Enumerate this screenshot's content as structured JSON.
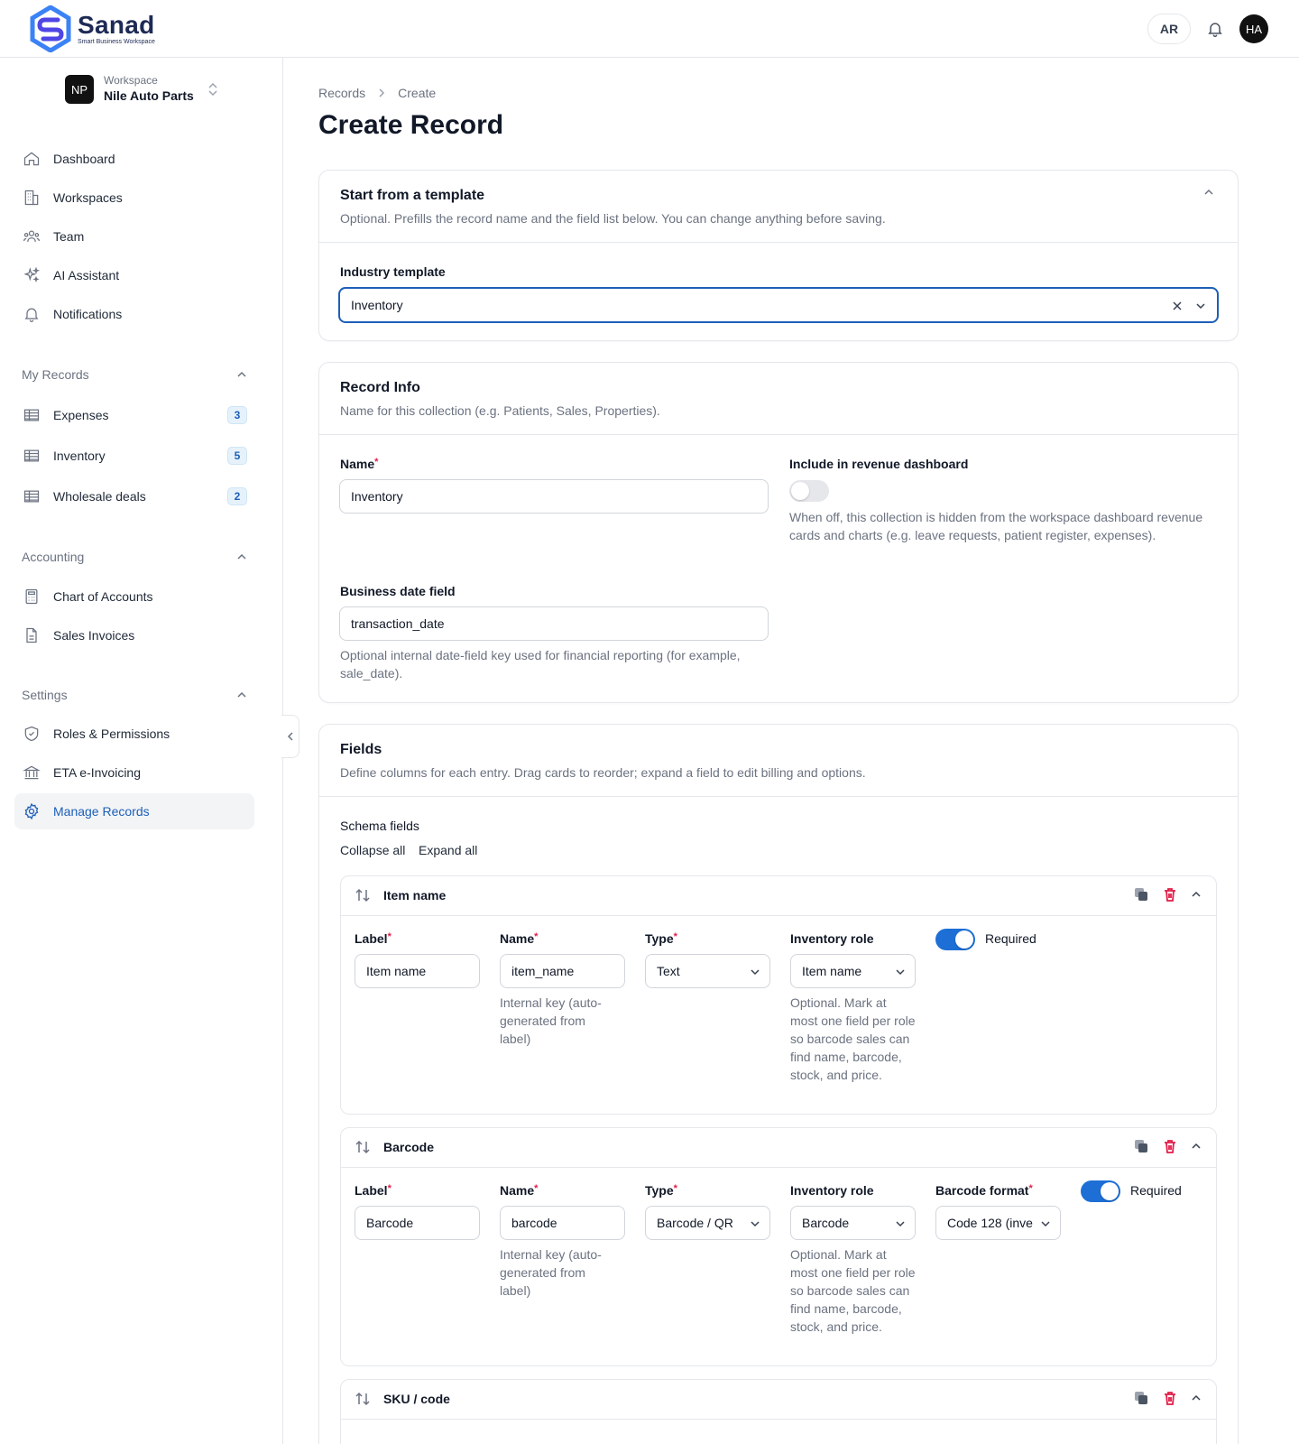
{
  "brand": {
    "name": "Sanad",
    "tagline": "Smart Business Workspace"
  },
  "topbar": {
    "lang": "AR",
    "avatar": "HA"
  },
  "workspace": {
    "badge": "NP",
    "label": "Workspace",
    "name": "Nile Auto Parts"
  },
  "nav": {
    "main": [
      "Dashboard",
      "Workspaces",
      "Team",
      "AI Assistant",
      "Notifications"
    ],
    "my_records_title": "My Records",
    "my_records": [
      {
        "label": "Expenses",
        "count": "3"
      },
      {
        "label": "Inventory",
        "count": "5"
      },
      {
        "label": "Wholesale deals",
        "count": "2"
      }
    ],
    "accounting_title": "Accounting",
    "accounting": [
      "Chart of Accounts",
      "Sales Invoices"
    ],
    "settings_title": "Settings",
    "settings": [
      "Roles & Permissions",
      "ETA e-Invoicing",
      "Manage Records"
    ]
  },
  "breadcrumb": {
    "root": "Records",
    "current": "Create"
  },
  "page_title": "Create Record",
  "template_card": {
    "title": "Start from a template",
    "subtitle": "Optional. Prefills the record name and the field list below. You can change anything before saving.",
    "label": "Industry template",
    "value": "Inventory"
  },
  "info_card": {
    "title": "Record Info",
    "subtitle": "Name for this collection (e.g. Patients, Sales, Properties).",
    "name_label": "Name",
    "name_value": "Inventory",
    "revenue_label": "Include in revenue dashboard",
    "revenue_on": false,
    "revenue_help": "When off, this collection is hidden from the workspace dashboard revenue cards and charts (e.g. leave requests, patient register, expenses).",
    "date_label": "Business date field",
    "date_value": "transaction_date",
    "date_help": "Optional internal date-field key used for financial reporting (for example, sale_date)."
  },
  "fields_card": {
    "title": "Fields",
    "subtitle": "Define columns for each entry. Drag cards to reorder; expand a field to edit billing and options.",
    "schema_title": "Schema fields",
    "collapse_all": "Collapse all",
    "expand_all": "Expand all",
    "labels": {
      "label": "Label",
      "name": "Name",
      "type": "Type",
      "role": "Inventory role",
      "barcode_format": "Barcode format",
      "required": "Required"
    },
    "name_help": "Internal key (auto-generated from label)",
    "role_help": "Optional. Mark at most one field per role so barcode sales can find name, barcode, stock, and price.",
    "fields": [
      {
        "title": "Item name",
        "label": "Item name",
        "name": "item_name",
        "type": "Text",
        "role": "Item name",
        "required": true
      },
      {
        "title": "Barcode",
        "label": "Barcode",
        "name": "barcode",
        "type": "Barcode / QR",
        "role": "Barcode",
        "format": "Code 128 (inve",
        "required": true
      },
      {
        "title": "SKU / code"
      }
    ]
  },
  "colors": {
    "accent": "#1d5fb8",
    "toggle_on": "#1d6fd6",
    "danger": "#e11d48"
  }
}
